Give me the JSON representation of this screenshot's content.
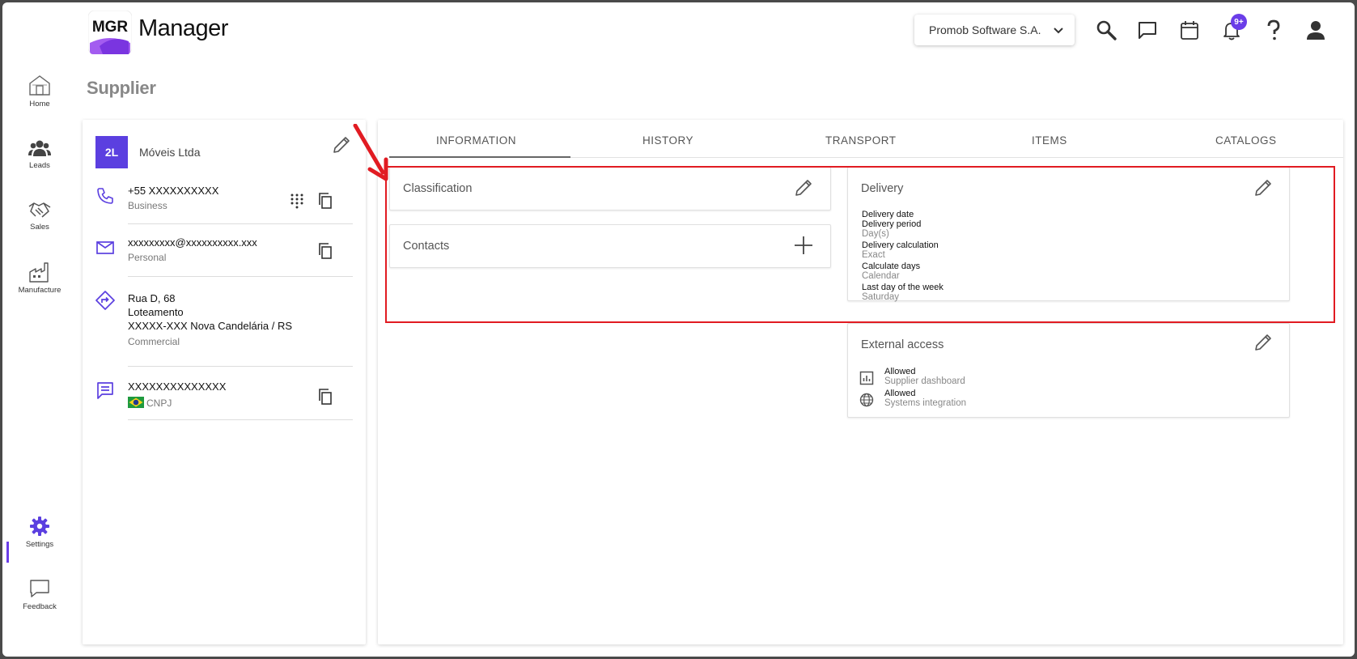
{
  "header": {
    "logo_text": "MGR",
    "app_title": "Manager",
    "company": "Promob Software S.A.",
    "notification_badge": "9+"
  },
  "sidebar": {
    "items": [
      {
        "label": "Home",
        "icon": "home-icon"
      },
      {
        "label": "Leads",
        "icon": "people-icon"
      },
      {
        "label": "Sales",
        "icon": "handshake-icon"
      },
      {
        "label": "Manufacture",
        "icon": "factory-icon"
      },
      {
        "label": "Settings",
        "icon": "gear-icon"
      },
      {
        "label": "Feedback",
        "icon": "chat-bubble-icon"
      }
    ],
    "active": "Settings"
  },
  "page": {
    "title": "Supplier"
  },
  "supplier": {
    "initials": "2L",
    "name": "Móveis Ltda",
    "phone": {
      "value": "+55 XXXXXXXXXX",
      "type": "Business"
    },
    "email": {
      "value": "xxxxxxxxx@xxxxxxxxxx.xxx",
      "type": "Personal"
    },
    "address": {
      "line1": "Rua D, 68",
      "line2": "Loteamento",
      "line3": "XXXXX-XXX Nova Candelária / RS",
      "type": "Commercial"
    },
    "document": {
      "value": "XXXXXXXXXXXXXX",
      "type": "CNPJ"
    }
  },
  "tabs": [
    "INFORMATION",
    "HISTORY",
    "TRANSPORT",
    "ITEMS",
    "CATALOGS"
  ],
  "active_tab": "INFORMATION",
  "cards": {
    "classification": {
      "title": "Classification"
    },
    "contacts": {
      "title": "Contacts"
    },
    "delivery": {
      "title": "Delivery",
      "fields": [
        {
          "label": "Delivery date",
          "value": ""
        },
        {
          "label": "Delivery period",
          "value": "Day(s)"
        },
        {
          "label": "Delivery calculation",
          "value": "Exact"
        },
        {
          "label": "Calculate days",
          "value": "Calendar"
        },
        {
          "label": "Last day of the week",
          "value": "Saturday"
        }
      ]
    },
    "external_access": {
      "title": "External access",
      "items": [
        {
          "status": "Allowed",
          "label": "Supplier dashboard",
          "icon": "chart-icon"
        },
        {
          "status": "Allowed",
          "label": "Systems integration",
          "icon": "globe-icon"
        }
      ]
    }
  },
  "colors": {
    "accent": "#6a3de8",
    "avatar": "#5b3fe0",
    "highlight": "#e11b22"
  }
}
